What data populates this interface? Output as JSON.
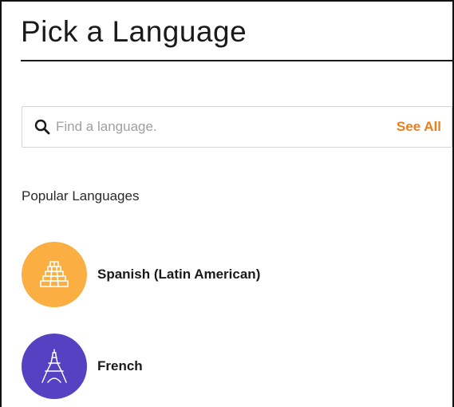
{
  "page": {
    "title": "Pick a Language"
  },
  "search": {
    "placeholder": "Find a language.",
    "value": "",
    "see_all_label": "See All",
    "icon": "search-icon"
  },
  "popular": {
    "heading": "Popular Languages",
    "items": [
      {
        "label": "Spanish (Latin American)",
        "icon": "pyramid-icon",
        "color": "#fbae42"
      },
      {
        "label": "French",
        "icon": "eiffel-tower-icon",
        "color": "#5541c1"
      }
    ]
  },
  "colors": {
    "accent": "#f07d1a",
    "text": "#1a1a1a"
  }
}
